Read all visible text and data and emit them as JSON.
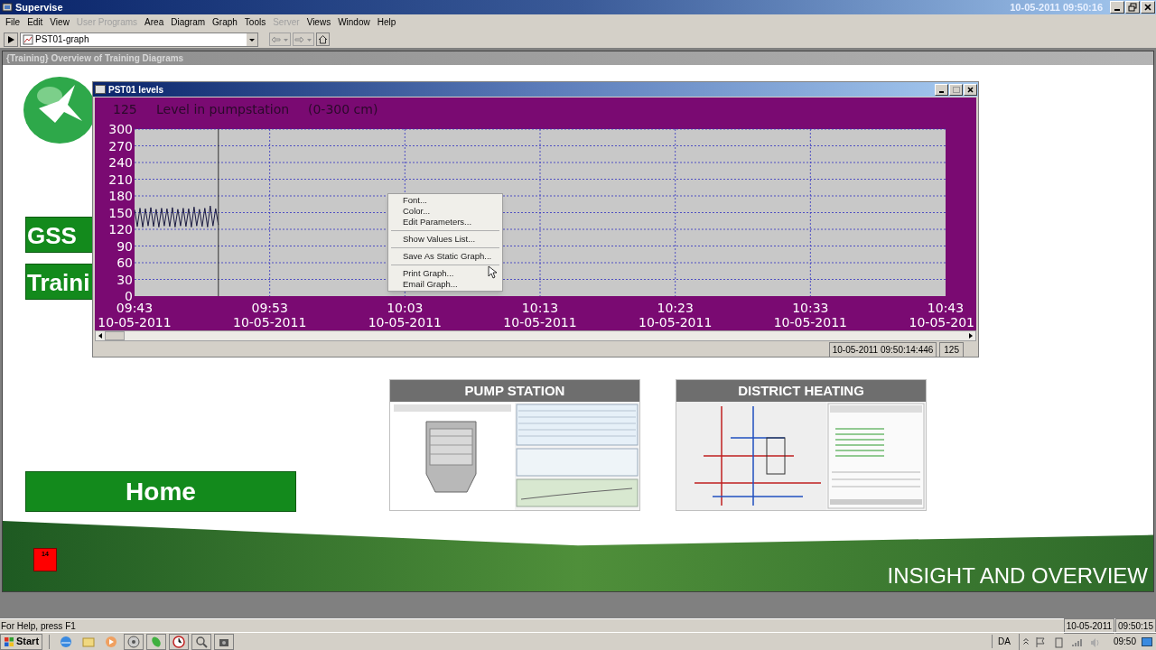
{
  "window": {
    "title": "Supervise",
    "clock": "10-05-2011  09:50:16"
  },
  "menu_bar": [
    {
      "label": "File",
      "disabled": false
    },
    {
      "label": "Edit",
      "disabled": false
    },
    {
      "label": "View",
      "disabled": false
    },
    {
      "label": "User Programs",
      "disabled": true
    },
    {
      "label": "Area",
      "disabled": false
    },
    {
      "label": "Diagram",
      "disabled": false
    },
    {
      "label": "Graph",
      "disabled": false
    },
    {
      "label": "Tools",
      "disabled": false
    },
    {
      "label": "Server",
      "disabled": true
    },
    {
      "label": "Views",
      "disabled": false
    },
    {
      "label": "Window",
      "disabled": false
    },
    {
      "label": "Help",
      "disabled": false
    }
  ],
  "toolbar": {
    "diagram_select": "PST01-graph"
  },
  "diagram_window": {
    "title": "{Training} Overview of Training Diagrams",
    "banners": [
      "GSS",
      "Traini"
    ],
    "home_button": "Home",
    "thumbnails": [
      {
        "title": "PUMP STATION",
        "kind": "pump"
      },
      {
        "title": "DISTRICT HEATING",
        "kind": "heating"
      }
    ],
    "alarm_badge": "14",
    "slogan": "INSIGHT AND OVERVIEW"
  },
  "graph_window": {
    "title": "PST01 levels",
    "current_value": "125",
    "range": "(0-300 cm)",
    "x_dates": [
      "10-05-2011",
      "10-05-2011",
      "10-05-2011",
      "10-05-2011",
      "10-05-2011",
      "10-05-2011",
      "10-05-201"
    ],
    "chart_data": {
      "type": "line",
      "grid": true,
      "ref_lines": [
        {
          "axis": "x",
          "value": 589.2,
          "color": "#303030"
        }
      ],
      "title": "Level in pumpstation",
      "ylim": [
        0,
        300
      ],
      "yticks": [
        0,
        30,
        60,
        90,
        120,
        150,
        180,
        210,
        240,
        270,
        300
      ],
      "xlim": [
        583,
        643
      ],
      "xticks": [
        {
          "value": 583,
          "label": "09:43"
        },
        {
          "value": 593,
          "label": "09:53"
        },
        {
          "value": 603,
          "label": "10:03"
        },
        {
          "value": 613,
          "label": "10:13"
        },
        {
          "value": 623,
          "label": "10:23"
        },
        {
          "value": 633,
          "label": "10:33"
        },
        {
          "value": 643,
          "label": "10:43"
        }
      ],
      "x": [
        583,
        583.2,
        583.4,
        583.6,
        583.8,
        584,
        584.2,
        584.4,
        584.6,
        584.8,
        585,
        585.2,
        585.4,
        585.6,
        585.8,
        586,
        586.2,
        586.4,
        586.6,
        586.8,
        587,
        587.2,
        587.4,
        587.6,
        587.8,
        588,
        588.2,
        588.4,
        588.6,
        588.8,
        589,
        589.2
      ],
      "series": [
        {
          "color": "#1a1a40",
          "values": [
            155,
            125,
            158,
            124,
            157,
            126,
            159,
            125,
            156,
            124,
            158,
            126,
            157,
            125,
            159,
            124,
            156,
            126,
            158,
            125,
            157,
            124,
            160,
            126,
            156,
            125,
            158,
            124,
            162,
            126,
            157,
            128
          ]
        }
      ]
    },
    "status": {
      "timestamp": "10-05-2011 09:50:14:446",
      "value": "125"
    }
  },
  "context_menu": {
    "groups": [
      [
        "Font...",
        "Color...",
        "Edit Parameters..."
      ],
      [
        "Show Values List..."
      ],
      [
        "Save As Static Graph..."
      ],
      [
        "Print Graph...",
        "Email Graph..."
      ]
    ]
  },
  "status_bar": {
    "help": "For Help, press F1",
    "date": "10-05-2011",
    "time": "09:50:15"
  },
  "taskbar": {
    "start": "Start",
    "language": "DA",
    "clock": "09:50"
  }
}
